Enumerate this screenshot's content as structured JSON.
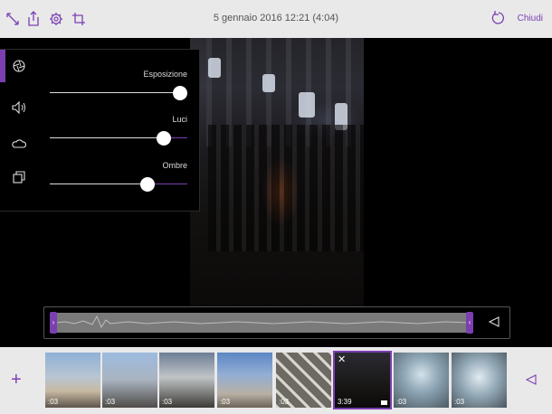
{
  "header": {
    "title": "5 gennaio 2016 12:21 (4:04)",
    "close_label": "Chiudi",
    "left_icons": [
      "resize-arrows-icon",
      "share-icon",
      "gear-icon",
      "crop-icon"
    ],
    "undo_icon": "undo-icon"
  },
  "adjust_panel": {
    "tools": [
      "lens-icon",
      "audio-icon",
      "cloud-icon",
      "duplicate-icon"
    ],
    "sliders": [
      {
        "label": "Esposizione",
        "value": 0.95
      },
      {
        "label": "Luci",
        "value": 0.83
      },
      {
        "label": "Ombre",
        "value": 0.71
      }
    ]
  },
  "timeline": {
    "left_handle": "›",
    "right_handle": "‹"
  },
  "filmstrip": {
    "add_label": "+",
    "thumbs": [
      {
        "duration": ":03",
        "scene": "cathedral-spires",
        "selected": false
      },
      {
        "duration": ":03",
        "scene": "cathedral-roof",
        "selected": false
      },
      {
        "duration": ":03",
        "scene": "cathedral-spires-dark",
        "selected": false
      },
      {
        "duration": ":03",
        "scene": "cathedral-roof-blue",
        "selected": false
      },
      {
        "duration": ":03",
        "scene": "lattice-glass",
        "selected": false
      },
      {
        "duration": "3:39",
        "scene": "night-crowd-video",
        "selected": true
      },
      {
        "duration": ":03",
        "scene": "galleria-dome",
        "selected": false
      },
      {
        "duration": ":03",
        "scene": "galleria-dome-2",
        "selected": false
      }
    ]
  },
  "colors": {
    "accent": "#7b3fb0",
    "bar": "#e9e9ea"
  }
}
